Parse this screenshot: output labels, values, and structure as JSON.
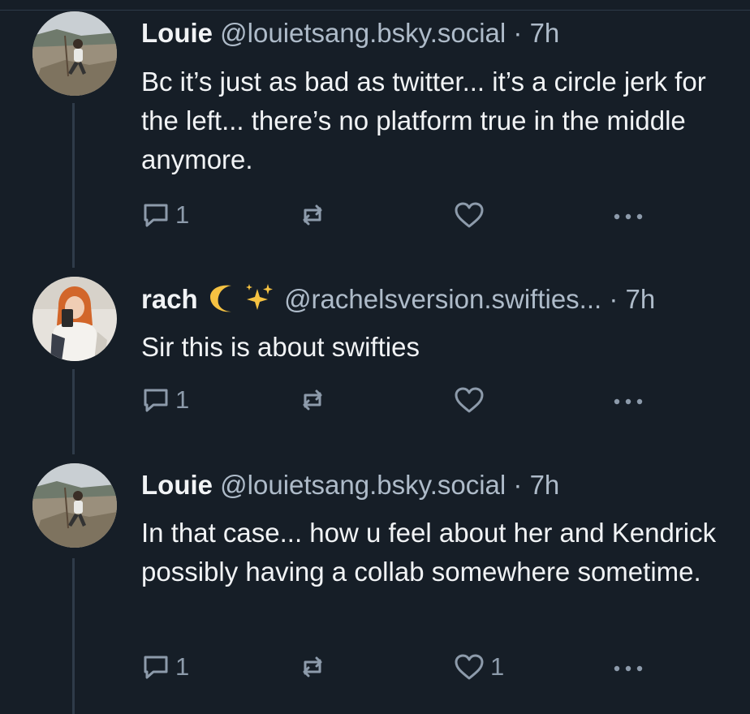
{
  "posts": [
    {
      "name": "Louie",
      "handle": "@louietsang.bsky.social",
      "separator": "·",
      "time": "7h",
      "text": "Bc it’s just as bad as twitter... it’s a circle jerk for the left... there’s no platform true in the middle anymore.",
      "reply_count": "1",
      "repost_count": "",
      "like_count": "",
      "avatar": "louie-avatar"
    },
    {
      "name": "rach",
      "name_emoji": [
        "crescent-moon",
        "sparkles"
      ],
      "handle": "@rachelsversion.swifties...",
      "separator": "·",
      "time": "7h",
      "text": "Sir this is about swifties",
      "reply_count": "1",
      "repost_count": "",
      "like_count": "",
      "avatar": "rach-avatar"
    },
    {
      "name": "Louie",
      "handle": "@louietsang.bsky.social",
      "separator": "·",
      "time": "7h",
      "text": "In that case... how u feel about her and Kendrick possibly having a collab somewhere sometime.",
      "reply_count": "1",
      "repost_count": "",
      "like_count": "1",
      "avatar": "louie-avatar"
    }
  ],
  "icons": {
    "reply": "reply-icon",
    "repost": "repost-icon",
    "like": "heart-icon",
    "more": "more-icon"
  },
  "colors": {
    "background": "#161e27",
    "text": "#f1f3f5",
    "muted": "#aebbc9",
    "icon": "#8d9bab",
    "thread_line": "#2f3b49"
  }
}
